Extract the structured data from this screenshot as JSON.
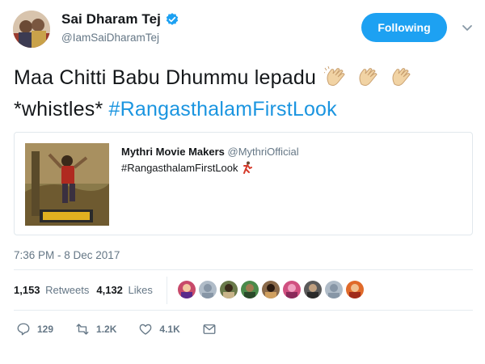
{
  "user": {
    "name": "Sai Dharam Tej",
    "handle": "@IamSaiDharamTej",
    "verified": true
  },
  "follow_button": {
    "label": "Following"
  },
  "tweet": {
    "text_main": "Maa Chitti Babu Dhummu lepadu",
    "text_line2": "*whistles*",
    "hashtag": "#RangasthalamFirstLook",
    "emoji": [
      "clapping-hands",
      "clapping-hands",
      "clapping-hands"
    ]
  },
  "quoted": {
    "name": "Mythri Movie Makers",
    "handle": "@MythriOfficial",
    "text": "#RangasthalamFirstLook",
    "emoji": "man-dancing"
  },
  "timestamp": "7:36 PM - 8 Dec 2017",
  "stats": {
    "retweets_count": "1,153",
    "retweets_label": "Retweets",
    "likes_count": "4,132",
    "likes_label": "Likes",
    "liker_avatars": 9
  },
  "actions": {
    "replies": "129",
    "retweets": "1.2K",
    "likes": "4.1K"
  },
  "colors": {
    "accent": "#1da1f2",
    "hashtag": "#1b95e0",
    "muted": "#657786"
  }
}
